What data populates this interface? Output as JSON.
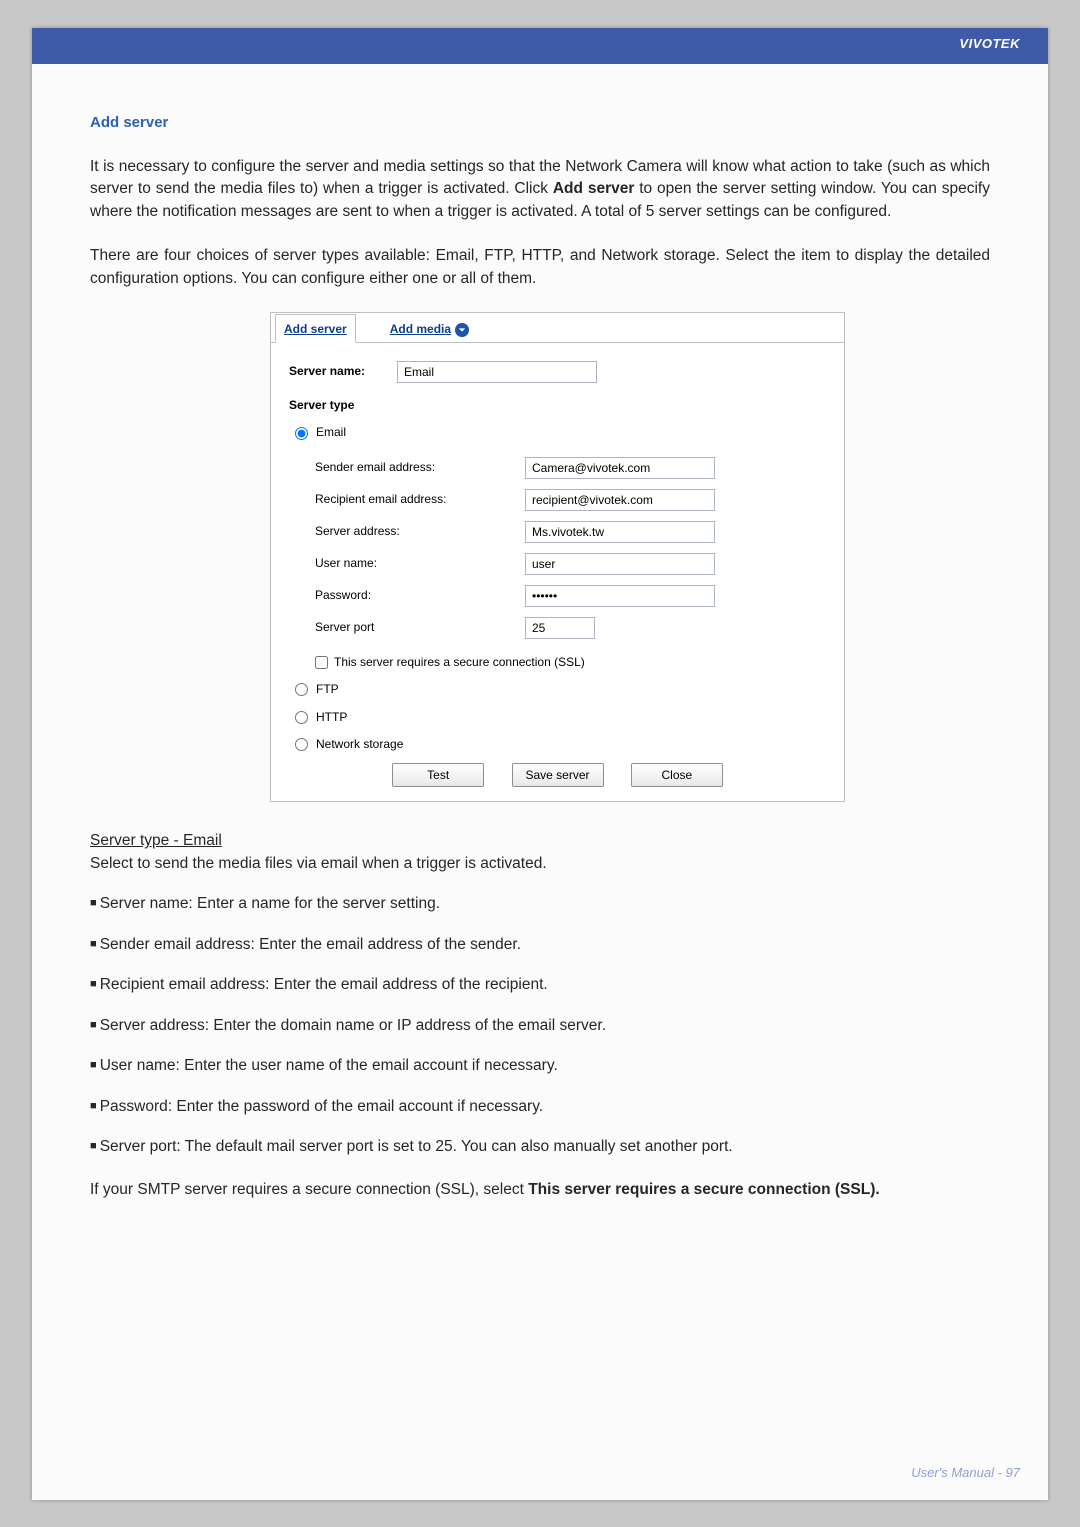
{
  "header": {
    "brand": "VIVOTEK"
  },
  "section_title": "Add server",
  "para1_a": "It is necessary to configure the server and media settings so that the Network Camera will know what action to take (such as which server to send the media files to) when a trigger is activated. Click ",
  "para1_b_bold": "Add server",
  "para1_c": " to open the server setting window. You can specify where the notification messages are sent to when a trigger is activated. A total of 5 server settings can be configured.",
  "para2": "There are four choices of server types available: Email, FTP, HTTP, and Network storage. Select the item to display the detailed configuration options. You can configure either one or all of them.",
  "panel": {
    "tabs": {
      "add_server": "Add server",
      "add_media": "Add media"
    },
    "server_name_label": "Server name:",
    "server_name_value": "Email",
    "server_type_label": "Server type",
    "radios": {
      "email": "Email",
      "ftp": "FTP",
      "http": "HTTP",
      "network_storage": "Network storage"
    },
    "fields": {
      "sender_label": "Sender email address:",
      "sender_value": "Camera@vivotek.com",
      "recipient_label": "Recipient email address:",
      "recipient_value": "recipient@vivotek.com",
      "address_label": "Server address:",
      "address_value": "Ms.vivotek.tw",
      "user_label": "User name:",
      "user_value": "user",
      "password_label": "Password:",
      "password_value": "••••••",
      "port_label": "Server port",
      "port_value": "25",
      "ssl_label": "This server requires a secure connection (SSL)"
    },
    "buttons": {
      "test": "Test",
      "save": "Save server",
      "close": "Close"
    }
  },
  "subhead": "Server type - Email",
  "sub_desc": "Select to send the media files via email when a trigger is activated.",
  "bullets": [
    "Server name: Enter a name for the server setting.",
    "Sender email address: Enter the email address of the sender.",
    "Recipient email address: Enter the email address of the recipient.",
    "Server address: Enter the domain name or IP address of the email server.",
    "User name: Enter the user name of the email account if necessary.",
    "Password: Enter the password of the email account if necessary.",
    "Server port: The default mail server port is set to 25. You can also manually set another port."
  ],
  "last_para_a": "If your SMTP server requires a secure connection (SSL), select ",
  "last_para_b_bold": "This server requires a secure connection (SSL).",
  "footer": "User's Manual - 97"
}
